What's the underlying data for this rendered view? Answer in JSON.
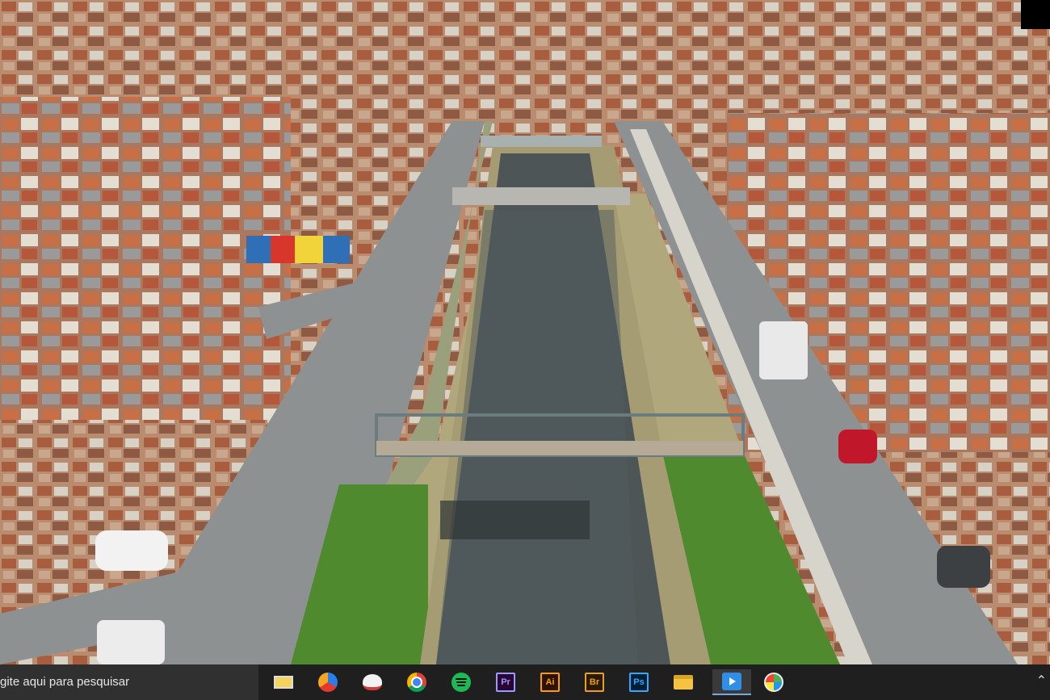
{
  "taskbar": {
    "search_placeholder": "gite aqui para pesquisar",
    "apps": [
      {
        "name": "app-icon",
        "label": ""
      },
      {
        "name": "app-icon",
        "label": ""
      },
      {
        "name": "app-icon",
        "label": ""
      },
      {
        "name": "chrome-icon",
        "label": ""
      },
      {
        "name": "spotify-icon",
        "label": ""
      },
      {
        "name": "premiere-icon",
        "label": "Pr"
      },
      {
        "name": "illustrator-icon",
        "label": "Ai"
      },
      {
        "name": "bridge-icon",
        "label": "Br"
      },
      {
        "name": "photoshop-icon",
        "label": "Ps"
      },
      {
        "name": "file-explorer-icon",
        "label": ""
      },
      {
        "name": "video-app-icon",
        "label": ""
      },
      {
        "name": "paint-icon",
        "label": ""
      }
    ]
  },
  "colors": {
    "premiere": "#9999ff",
    "illustrator": "#ff9a00",
    "bridge": "#e8a020",
    "photoshop": "#31a8ff",
    "spotify": "#1db954",
    "taskbar": "#1f1f1f"
  }
}
